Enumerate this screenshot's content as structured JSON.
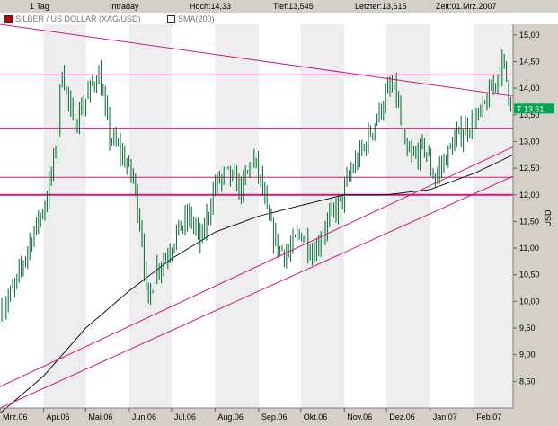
{
  "header": {
    "period": "1 Tag",
    "mode": "Intraday",
    "high": "Hoch:14,33",
    "low": "Tief:13,545",
    "last": "Letzter:13,615",
    "time": "Zeit:01.Mrz.2007"
  },
  "legend": {
    "series": "SILBER / US DOLLAR (XAG/USD)",
    "series_color": "#c00000",
    "sma": "SMA(200)",
    "sma_color": "#ffffff"
  },
  "colors": {
    "candle": "#006b2f",
    "sma": "#000000",
    "trendline": "#d4157d",
    "band": "#eeeeee",
    "marker": "#00a550"
  },
  "chart_data": {
    "type": "line",
    "title": "SILBER / US DOLLAR (XAG/USD)",
    "xlabel": "",
    "ylabel": "USD",
    "x_ticks": [
      "Mrz.06",
      "Apr.06",
      "Mai.06",
      "Jun.06",
      "Jul.06",
      "Aug.06",
      "Sep.06",
      "Okt.06",
      "Nov.06",
      "Dez.06",
      "Jan.07",
      "Feb.07"
    ],
    "y_ticks": [
      "8,50",
      "9,00",
      "9,50",
      "10,00",
      "10,50",
      "11,00",
      "11,50",
      "12,00",
      "12,50",
      "13,00",
      "13,50",
      "14,00",
      "14,50",
      "15,00"
    ],
    "ylim": [
      8.0,
      15.2
    ],
    "last_label": "T 13,61",
    "last_value": 13.61,
    "horizontal_levels": [
      14.25,
      13.25,
      12.33,
      12.0
    ],
    "trendlines": [
      {
        "name": "resistance",
        "points": [
          [
            "2006-03-01",
            15.2
          ],
          [
            "2007-03-01",
            13.85
          ]
        ]
      },
      {
        "name": "support-1",
        "points": [
          [
            "2006-03-01",
            8.4
          ],
          [
            "2007-03-01",
            12.9
          ]
        ]
      },
      {
        "name": "support-2",
        "points": [
          [
            "2006-03-01",
            8.0
          ],
          [
            "2007-03-01",
            12.35
          ]
        ]
      }
    ],
    "price_path": [
      [
        "2006-03-01",
        9.8
      ],
      [
        "2006-03-12",
        10.3
      ],
      [
        "2006-03-22",
        11.1
      ],
      [
        "2006-04-03",
        11.9
      ],
      [
        "2006-04-10",
        12.9
      ],
      [
        "2006-04-14",
        14.4
      ],
      [
        "2006-04-22",
        13.3
      ],
      [
        "2006-05-01",
        13.8
      ],
      [
        "2006-05-10",
        14.3
      ],
      [
        "2006-05-18",
        13.1
      ],
      [
        "2006-05-26",
        12.8
      ],
      [
        "2006-06-04",
        12.3
      ],
      [
        "2006-06-10",
        11.2
      ],
      [
        "2006-06-14",
        9.9
      ],
      [
        "2006-06-20",
        10.6
      ],
      [
        "2006-06-28",
        10.9
      ],
      [
        "2006-07-05",
        11.3
      ],
      [
        "2006-07-14",
        11.6
      ],
      [
        "2006-07-22",
        11.1
      ],
      [
        "2006-08-01",
        12.2
      ],
      [
        "2006-08-10",
        12.4
      ],
      [
        "2006-08-20",
        12.1
      ],
      [
        "2006-08-28",
        12.7
      ],
      [
        "2006-09-03",
        12.2
      ],
      [
        "2006-09-08",
        11.5
      ],
      [
        "2006-09-15",
        11.0
      ],
      [
        "2006-09-22",
        10.9
      ],
      [
        "2006-10-01",
        11.3
      ],
      [
        "2006-10-10",
        10.9
      ],
      [
        "2006-10-20",
        11.5
      ],
      [
        "2006-10-30",
        11.9
      ],
      [
        "2006-11-05",
        12.4
      ],
      [
        "2006-11-15",
        12.9
      ],
      [
        "2006-11-25",
        13.5
      ],
      [
        "2006-12-03",
        14.0
      ],
      [
        "2006-12-08",
        13.9
      ],
      [
        "2006-12-14",
        12.8
      ],
      [
        "2006-12-20",
        12.7
      ],
      [
        "2006-12-28",
        12.9
      ],
      [
        "2007-01-04",
        12.3
      ],
      [
        "2007-01-10",
        12.6
      ],
      [
        "2007-01-18",
        13.0
      ],
      [
        "2007-01-28",
        13.3
      ],
      [
        "2007-02-06",
        13.5
      ],
      [
        "2007-02-14",
        14.0
      ],
      [
        "2007-02-22",
        14.5
      ],
      [
        "2007-02-26",
        13.9
      ],
      [
        "2007-03-01",
        13.61
      ]
    ],
    "sma200": [
      [
        "2006-03-01",
        7.9
      ],
      [
        "2006-04-01",
        8.6
      ],
      [
        "2006-05-01",
        9.5
      ],
      [
        "2006-06-01",
        10.2
      ],
      [
        "2006-07-01",
        10.8
      ],
      [
        "2006-08-01",
        11.3
      ],
      [
        "2006-09-01",
        11.6
      ],
      [
        "2006-10-01",
        11.8
      ],
      [
        "2006-11-01",
        12.0
      ],
      [
        "2006-12-01",
        12.0
      ],
      [
        "2007-01-01",
        12.1
      ],
      [
        "2007-02-01",
        12.4
      ],
      [
        "2007-03-01",
        12.75
      ]
    ]
  }
}
